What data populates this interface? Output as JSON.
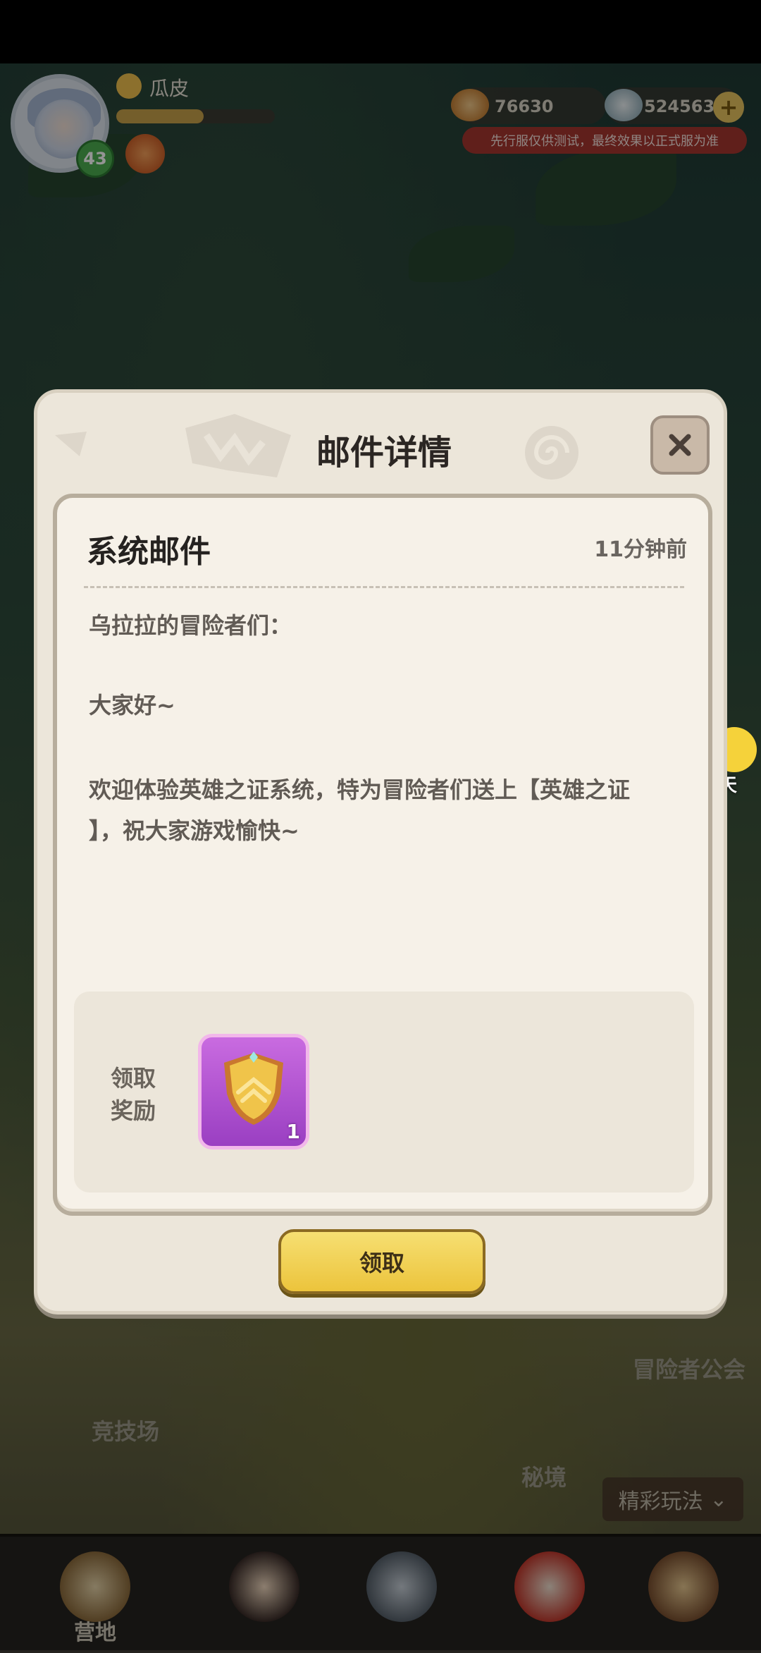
{
  "hud": {
    "player_name": "瓜皮",
    "level": "43",
    "exp_progress": 0.55,
    "gold": "76630",
    "diamonds": "524563",
    "test_notice": "先行服仅供测试，最终效果以正式服为准"
  },
  "chat": {
    "label": "聊天"
  },
  "scene": {
    "labels": {
      "adventurer_guild": "冒险者公会",
      "arena": "竞技场",
      "secret_realm": "秘境"
    },
    "more_button": "精彩玩法"
  },
  "bottom_nav": {
    "camp": "营地"
  },
  "mail": {
    "title": "邮件详情",
    "type": "系统邮件",
    "time": "11分钟前",
    "greeting": "乌拉拉的冒险者们：",
    "hello": "大家好~",
    "body_line1": "欢迎体验英雄之证系统，特为冒险者们送上【英雄之证",
    "body_line2": "】，祝大家游戏愉快~",
    "reward_label_line1": "领取",
    "reward_label_line2": "奖励",
    "reward_count": "1",
    "claim_button": "领取"
  },
  "colors": {
    "accent_yellow": "#ecc43c",
    "reward_purple": "#9a3fc2",
    "level_green": "#4caf50",
    "notice_red": "#a5362f"
  }
}
